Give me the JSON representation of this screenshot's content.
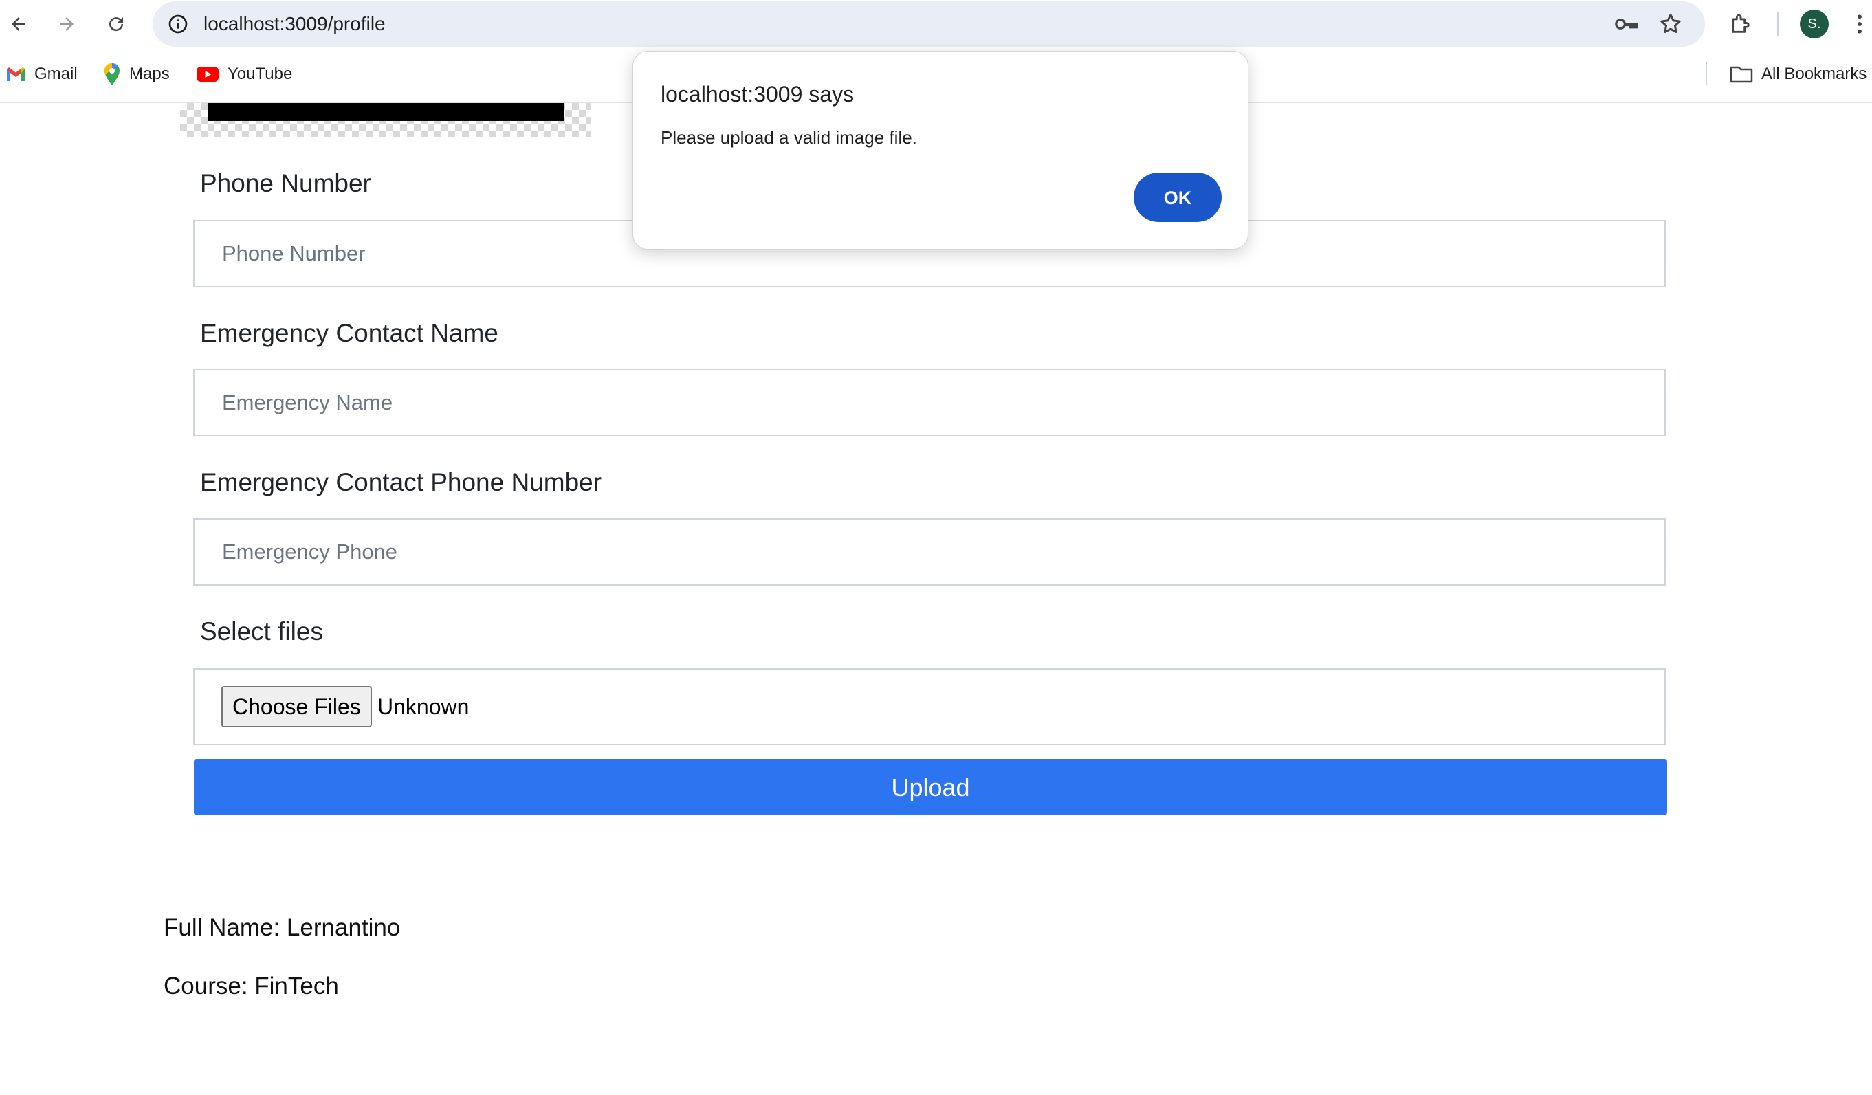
{
  "browser": {
    "url": "localhost:3009/profile",
    "avatar_initial": "S.",
    "bookmarks": [
      {
        "label": "Gmail",
        "icon": "gmail-icon"
      },
      {
        "label": "Maps",
        "icon": "maps-icon"
      },
      {
        "label": "YouTube",
        "icon": "youtube-icon"
      }
    ],
    "all_bookmarks_label": "All Bookmarks"
  },
  "form": {
    "phone": {
      "label": "Phone Number",
      "placeholder": "Phone Number"
    },
    "emergency_name": {
      "label": "Emergency Contact Name",
      "placeholder": "Emergency Name"
    },
    "emergency_phone": {
      "label": "Emergency Contact Phone Number",
      "placeholder": "Emergency Phone"
    },
    "files": {
      "label": "Select files",
      "button_label": "Choose Files",
      "status": "Unknown"
    },
    "upload_label": "Upload"
  },
  "profile": {
    "full_name_line": "Full Name: Lernantino",
    "course_line": "Course: FinTech"
  },
  "dialog": {
    "title": "localhost:3009 says",
    "message": "Please upload a valid image file.",
    "ok_label": "OK"
  },
  "colors": {
    "accent": "#2d74f0",
    "dialog_button": "#1a56c8",
    "omnibox_bg": "#e9eef6"
  }
}
